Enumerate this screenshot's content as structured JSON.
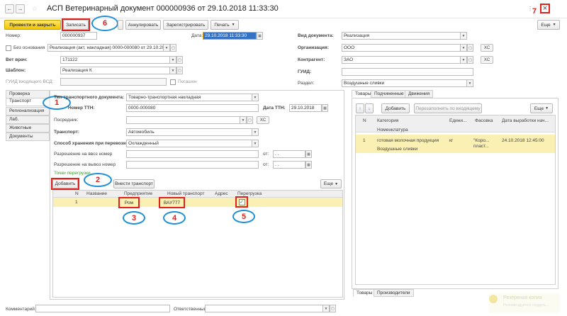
{
  "window": {
    "title": "АСП Ветеринарный документ 000000936 от 29.10.2018 11:33:30",
    "back": "←",
    "forward": "→",
    "star": "☆",
    "more_dots": "⋮",
    "link_icon": "🔗",
    "close": "×"
  },
  "toolbar": {
    "post_close": "Провести и закрыть",
    "save": "Записать",
    "annul": "Аннулировать",
    "register": "Зарегистрировать",
    "print": "Печать",
    "more": "Еще"
  },
  "header_fields": {
    "number_label": "Номер:",
    "number_value": "000000937",
    "date_label": "Дата:",
    "date_value": "29.10.2018 11:33:30",
    "no_basis_label": "Без основания",
    "basis_value": "Реализация (акт, накладная) 0000-000080 от 29.10.2018 1",
    "vet_label": "Вет врач:",
    "vet_value": "171122",
    "template_label": "Шаблон:",
    "template_value": "Реализация К",
    "guid_label": "ГУИД входящего ВСД:",
    "repaid_label": "Погашен",
    "doc_kind_label": "Вид документа:",
    "doc_kind_value": "Реализация",
    "org_label": "Организация:",
    "org_value": "ООО",
    "contractor_label": "Контрагент:",
    "contractor_value": "ЗАО",
    "guid2_label": "ГУИД:",
    "section_label": "Раздел:",
    "section_value": "Воздушные сливки",
    "xs": "XC"
  },
  "sidebar": {
    "items": [
      {
        "label": "Проверка"
      },
      {
        "label": "Транспорт"
      },
      {
        "label": "Регионализация"
      },
      {
        "label": "Лаб. исследования"
      },
      {
        "label": "Животные"
      },
      {
        "label": "Документы"
      }
    ]
  },
  "transport": {
    "doc_type_label": "Тип транспортного документа:",
    "doc_type_value": "Товарно-транспортная накладная",
    "ttn_num_label": "Номер ТТН:",
    "ttn_num_value": "0000-000080",
    "ttn_date_label": "Дата ТТН:",
    "ttn_date_value": "29.10.2018",
    "intermediary_label": "Посредник:",
    "transport_label": "Транспорт:",
    "transport_value": "Автомобиль",
    "storage_label": "Способ хранения при перевозке:",
    "storage_value": "Охлажденный",
    "import_label": "Разрешение на ввоз номер",
    "export_label": "Разрешение на вывоз номер",
    "from_label": "от:",
    "date_placeholder": ". .",
    "reload_label": "Точки перегрузки",
    "add": "Добавить",
    "enter_transport": "Внести транспорт",
    "more": "Еще",
    "columns": [
      "N",
      "Название",
      "Предприятие",
      "Новый транспорт",
      "Адрес",
      "Перегрузка"
    ],
    "rows": [
      {
        "n": "1",
        "name": "",
        "enterprise": "Ром",
        "transport": "ВАУ777",
        "address": "",
        "reload": "✓"
      }
    ]
  },
  "goods": {
    "tabs": [
      "Товары",
      "Подчиненные",
      "Движения"
    ],
    "add": "Добавить",
    "refill": "Перезаполнить по входящему",
    "more": "Еще",
    "up": "↑",
    "down": "↓",
    "columns": [
      "N",
      "Категория",
      "Едини...",
      "Фасовка",
      "Дата выработки нач..."
    ],
    "subheader": "Номенклатура",
    "rows": [
      {
        "n": "1",
        "category": "готовая молочная продукция",
        "unit": "кг",
        "pack": "\"Коро... пласт...",
        "date": "24.10.2018 12:45:00",
        "nomenclature": "Воздушные сливки"
      }
    ],
    "bottom_tabs": [
      "Товары",
      "Производители"
    ]
  },
  "footer": {
    "comment_label": "Комментарий:",
    "responsible_label": "Ответственный:",
    "watermark_line1": "Резервная копия",
    "watermark_line2": "Рекомендуется создать..."
  },
  "annotations": {
    "n1": "1",
    "n2": "2",
    "n3": "3",
    "n4": "4",
    "n5": "5",
    "n6": "6",
    "n7": "7"
  },
  "colors": {
    "primary_button": "#f2c500",
    "annotation_box": "#e0221f",
    "annotation_circle": "#1f8fd6",
    "selection": "#3572c2",
    "row_highlight": "#fbf0b4"
  }
}
